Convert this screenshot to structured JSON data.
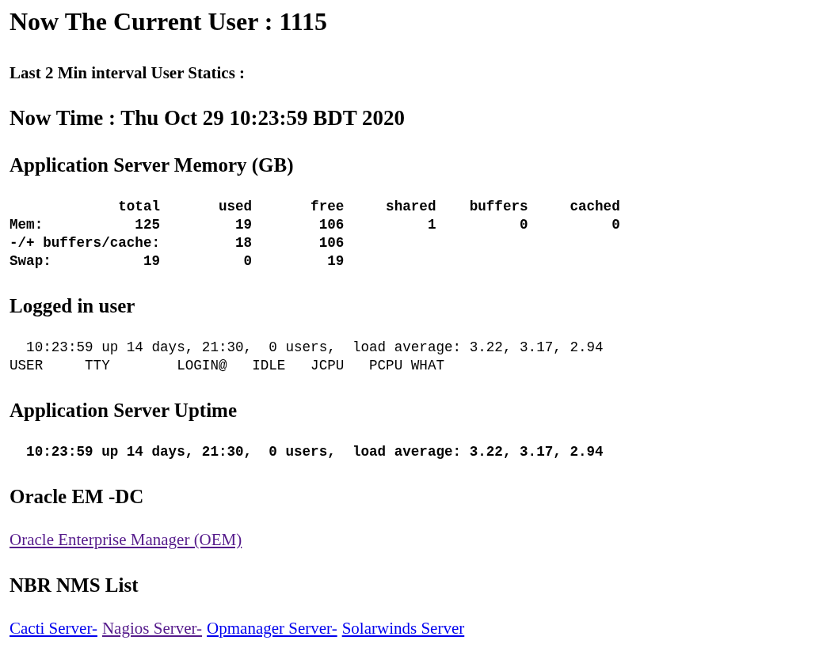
{
  "blocks": [
    {
      "kind": "title",
      "text": "Now The Current User : 1115"
    },
    {
      "kind": "subheading",
      "text": "Last 2 Min interval User Statics :"
    },
    {
      "kind": "time",
      "text": "Now Time : Thu Oct 29 10:23:59 BDT 2020"
    },
    {
      "kind": "heading",
      "text": "Application Server Memory (GB)"
    },
    {
      "kind": "pre",
      "bold": true,
      "lines": [
        "             total       used       free     shared    buffers     cached",
        "Mem:           125         19        106          1          0          0",
        "-/+ buffers/cache:         18        106",
        "Swap:           19          0         19"
      ]
    },
    {
      "kind": "heading",
      "text": "Logged in user"
    },
    {
      "kind": "pre",
      "bold": false,
      "lines": [
        "  10:23:59 up 14 days, 21:30,  0 users,  load average: 3.22, 3.17, 2.94",
        "USER     TTY        LOGIN@   IDLE   JCPU   PCPU WHAT"
      ]
    },
    {
      "kind": "heading",
      "text": "Application Server Uptime"
    },
    {
      "kind": "pre",
      "bold": true,
      "lines": [
        "  10:23:59 up 14 days, 21:30,  0 users,  load average: 3.22, 3.17, 2.94"
      ]
    },
    {
      "kind": "heading",
      "text": "Oracle EM -DC"
    },
    {
      "kind": "links",
      "links": [
        {
          "text": "Oracle Enterprise Manager (OEM)",
          "visited": true
        }
      ]
    },
    {
      "kind": "heading",
      "text": "NBR NMS List"
    },
    {
      "kind": "links",
      "links": [
        {
          "text": "Cacti Server-",
          "visited": false
        },
        {
          "text": "Nagios Server-",
          "visited": true
        },
        {
          "text": "Opmanager Server-",
          "visited": false
        },
        {
          "text": "Solarwinds Server",
          "visited": false
        }
      ]
    }
  ]
}
